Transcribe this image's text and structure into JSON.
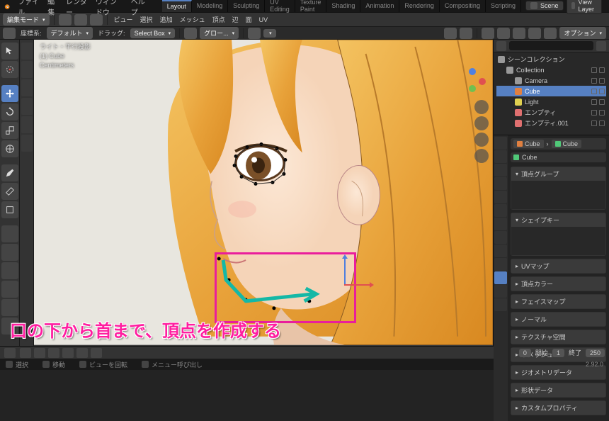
{
  "menubar": {
    "items": [
      "ファイル",
      "編集",
      "レンダー",
      "ウィンドウ",
      "ヘルプ"
    ]
  },
  "workspace": {
    "tabs": [
      "Layout",
      "Modeling",
      "Sculpting",
      "UV Editing",
      "Texture Paint",
      "Shading",
      "Animation",
      "Rendering",
      "Compositing",
      "Scripting"
    ],
    "active": 0,
    "scene_label": "Scene",
    "viewlayer_label": "View Layer"
  },
  "editor_header": {
    "mode": "編集モード",
    "menu1": "ビュー",
    "menu2": "選択",
    "menu3": "追加",
    "menu4": "メッシュ",
    "menu5": "頂点",
    "menu6": "辺",
    "menu7": "面",
    "menu8": "UV",
    "orientation_label": "座標系:",
    "orientation": "デフォルト",
    "drag_label": "ドラッグ:",
    "drag": "Select Box",
    "globals_label": "グロー...",
    "options": "オプション"
  },
  "viewport": {
    "info_line1": "ライト・平行投影",
    "info_line2": "(1) Cube",
    "info_line3": "Centimeters"
  },
  "outliner": {
    "root": "シーンコレクション",
    "collection": "Collection",
    "items": [
      {
        "name": "Camera",
        "type": "cam"
      },
      {
        "name": "Cube",
        "type": "mesh",
        "active": true
      },
      {
        "name": "Light",
        "type": "light"
      },
      {
        "name": "エンプティ",
        "type": "emp"
      },
      {
        "name": "エンプティ.001",
        "type": "emp"
      }
    ]
  },
  "properties": {
    "crumb_obj": "Cube",
    "crumb_mesh": "Cube",
    "field": "Cube",
    "panels": [
      "頂点グループ",
      "シェイプキー",
      "UVマップ",
      "頂点カラー",
      "フェイスマップ",
      "ノーマル",
      "テクスチャ空間",
      "リメッシュ",
      "ジオメトリデータ",
      "形状データ",
      "カスタムプロパティ"
    ]
  },
  "timeline": {
    "frame_label": "",
    "frame": "0",
    "start_label": "開始",
    "start": "1",
    "end_label": "終了",
    "end": "250"
  },
  "statusbar": {
    "item1": "選択",
    "item2": "移動",
    "item3": "ビューを回転",
    "item4": "メニュー呼び出し",
    "version": "2.92.0"
  },
  "caption": "口の下から首まで、頂点を作成する"
}
